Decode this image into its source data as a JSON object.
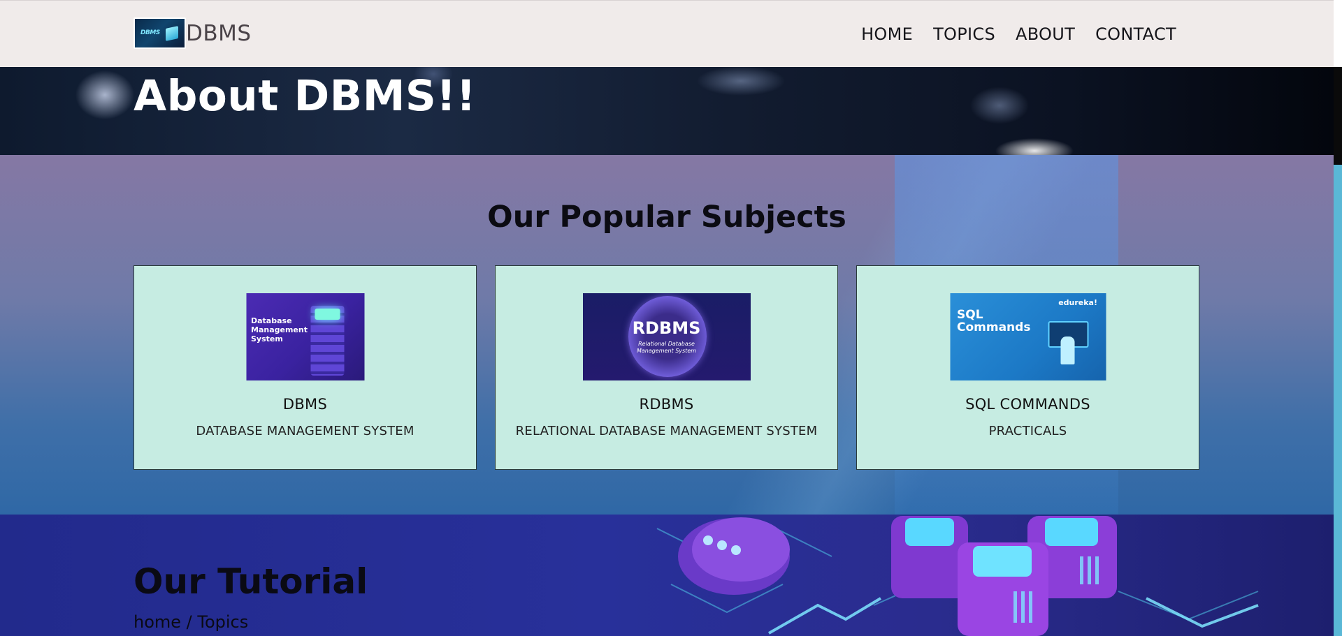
{
  "navbar": {
    "brand_name": "DBMS",
    "logo_text": "DBMS",
    "links": [
      "HOME",
      "TOPICS",
      "ABOUT",
      "CONTACT"
    ]
  },
  "hero": {
    "title": "About DBMS!!"
  },
  "subjects": {
    "heading": "Our Popular Subjects",
    "cards": [
      {
        "image_text": [
          "Database",
          "Management",
          "System"
        ],
        "title": "DBMS",
        "subtitle": "DATABASE MANAGEMENT SYSTEM"
      },
      {
        "image_text": [
          "RDBMS",
          "Relational Database",
          "Management System"
        ],
        "title": "RDBMS",
        "subtitle": "RELATIONAL DATABASE MANAGEMENT SYSTEM"
      },
      {
        "image_text": [
          "SQL",
          "Commands",
          "edureka!"
        ],
        "title": "SQL COMMANDS",
        "subtitle": "PRACTICALS"
      }
    ]
  },
  "tutorial": {
    "heading": "Our Tutorial",
    "breadcrumb": "home / Topics"
  },
  "colors": {
    "navbar_bg": "#f0ebea",
    "card_bg": "#c6ece2",
    "scrollbar": "#5ab8d6"
  },
  "icons": [
    "logo-icon",
    "server-cube-icon",
    "cloud-icon"
  ]
}
